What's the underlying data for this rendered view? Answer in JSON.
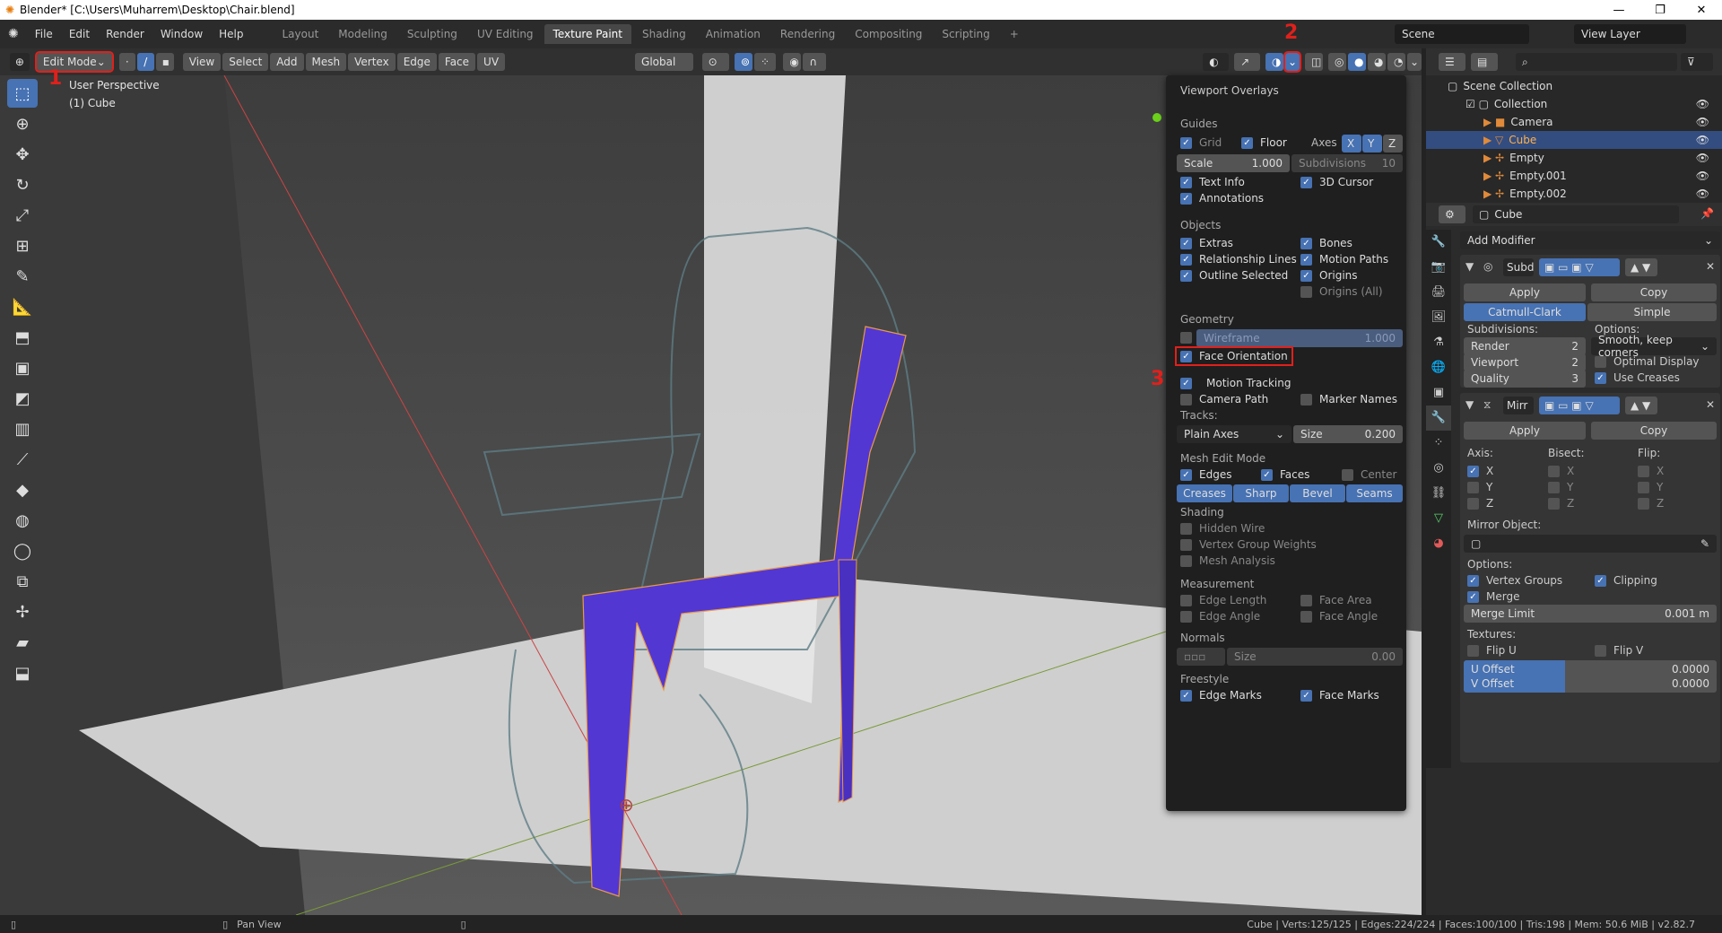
{
  "window": {
    "title": "Blender* [C:\\Users\\Muharrem\\Desktop\\Chair.blend]",
    "minimize": "—",
    "maximize": "❐",
    "close": "✕"
  },
  "menu": [
    "File",
    "Edit",
    "Render",
    "Window",
    "Help"
  ],
  "workspaces": [
    "Layout",
    "Modeling",
    "Sculpting",
    "UV Editing",
    "Texture Paint",
    "Shading",
    "Animation",
    "Rendering",
    "Compositing",
    "Scripting",
    "+"
  ],
  "scene": "Scene",
  "view_layer": "View Layer",
  "header": {
    "mode": "Edit Mode",
    "menus": [
      "View",
      "Select",
      "Add",
      "Mesh",
      "Vertex",
      "Edge",
      "Face",
      "UV"
    ],
    "transform": "Global"
  },
  "viewport": {
    "perspective": "User Perspective",
    "object": "(1) Cube"
  },
  "annotations": [
    "1",
    "2",
    "3"
  ],
  "overlays": {
    "title": "Viewport Overlays",
    "guides": "Guides",
    "grid": "Grid",
    "floor": "Floor",
    "axes": "Axes",
    "x": "X",
    "y": "Y",
    "z": "Z",
    "scale": "Scale",
    "scale_val": "1.000",
    "subdiv": "Subdivisions",
    "subdiv_val": "10",
    "text_info": "Text Info",
    "cursor3d": "3D Cursor",
    "annotations": "Annotations",
    "objects": "Objects",
    "extras": "Extras",
    "bones": "Bones",
    "rel_lines": "Relationship Lines",
    "motion_paths": "Motion Paths",
    "outline_sel": "Outline Selected",
    "origins": "Origins",
    "origins_all": "Origins (All)",
    "geometry": "Geometry",
    "wireframe": "Wireframe",
    "wireframe_val": "1.000",
    "face_orient": "Face Orientation",
    "motion_tracking": "Motion Tracking",
    "camera_path": "Camera Path",
    "marker_names": "Marker Names",
    "tracks": "Tracks:",
    "plain_axes": "Plain Axes",
    "size": "Size",
    "size_val": "0.200",
    "mesh_edit": "Mesh Edit Mode",
    "edges": "Edges",
    "faces": "Faces",
    "center": "Center",
    "creases": "Creases",
    "sharp": "Sharp",
    "bevel": "Bevel",
    "seams": "Seams",
    "shading": "Shading",
    "hidden_wire": "Hidden Wire",
    "vgroup_weights": "Vertex Group Weights",
    "mesh_analysis": "Mesh Analysis",
    "measurement": "Measurement",
    "edge_length": "Edge Length",
    "face_area": "Face Area",
    "edge_angle": "Edge Angle",
    "face_angle": "Face Angle",
    "normals": "Normals",
    "n_size": "Size",
    "n_size_val": "0.00",
    "freestyle": "Freestyle",
    "edge_marks": "Edge Marks",
    "face_marks": "Face Marks"
  },
  "outliner": {
    "root": "Scene Collection",
    "collection": "Collection",
    "items": [
      "Camera",
      "Cube",
      "Empty",
      "Empty.001",
      "Empty.002"
    ]
  },
  "properties": {
    "object": "Cube",
    "add_modifier": "Add Modifier",
    "subd": {
      "name": "Subd",
      "apply": "Apply",
      "copy": "Copy",
      "catmull": "Catmull-Clark",
      "simple": "Simple",
      "subdivisions": "Subdivisions:",
      "options": "Options:",
      "render": "Render",
      "render_val": "2",
      "viewport": "Viewport",
      "viewport_val": "2",
      "quality": "Quality",
      "quality_val": "3",
      "smooth": "Smooth, keep corners",
      "optimal": "Optimal Display",
      "creases": "Use Creases"
    },
    "mirror": {
      "name": "Mirr",
      "apply": "Apply",
      "copy": "Copy",
      "axis": "Axis:",
      "bisect": "Bisect:",
      "flip": "Flip:",
      "x": "X",
      "y": "Y",
      "z": "Z",
      "mirror_object": "Mirror Object:",
      "options": "Options:",
      "vgroups": "Vertex Groups",
      "clipping": "Clipping",
      "merge": "Merge",
      "merge_limit": "Merge Limit",
      "merge_val": "0.001 m",
      "textures": "Textures:",
      "flip_u": "Flip U",
      "flip_v": "Flip V",
      "u_offset": "U Offset",
      "u_val": "0.0000",
      "v_offset": "V Offset",
      "v_val": "0.0000"
    }
  },
  "status": {
    "pan": "Pan View",
    "stats": "Cube | Verts:125/125 | Edges:224/224 | Faces:100/100 | Tris:198 | Mem: 50.6 MiB | v2.82.7"
  }
}
